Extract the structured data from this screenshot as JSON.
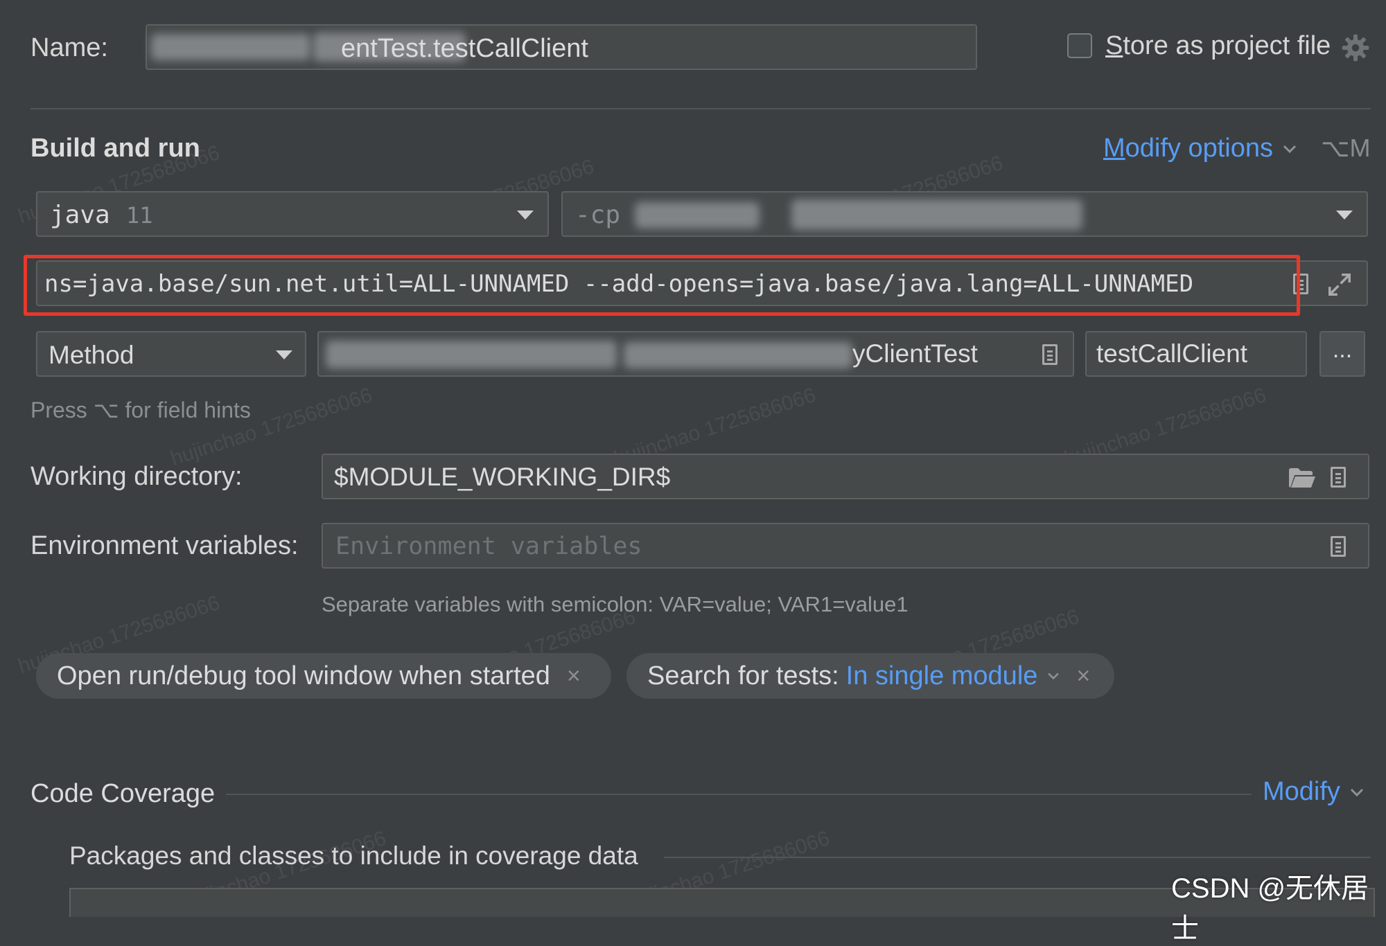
{
  "name_row": {
    "label": "Name:",
    "value_suffix": "entTest.testCallClient",
    "store_label_first": "S",
    "store_label_rest": "tore as project file"
  },
  "build_run": {
    "title": "Build and run",
    "modify_first": "M",
    "modify_rest": "odify options",
    "modify_shortcut": "⌥M",
    "jdk_name": "java",
    "jdk_version": "11",
    "cp_prefix": "-cp",
    "vm_options": "ns=java.base/sun.net.util=ALL-UNNAMED --add-opens=java.base/java.lang=ALL-UNNAMED",
    "test_kind": "Method",
    "class_suffix": "yClientTest",
    "method_name": "testCallClient",
    "more_button": "...",
    "hint": "Press ⌥ for field hints"
  },
  "working_dir": {
    "label": "Working directory:",
    "value": "$MODULE_WORKING_DIR$"
  },
  "env_vars": {
    "label": "Environment variables:",
    "placeholder": "Environment variables",
    "help": "Separate variables with semicolon: VAR=value; VAR1=value1"
  },
  "chips": {
    "open_tool_window": "Open run/debug tool window when started",
    "search_label": "Search for tests: ",
    "search_value": "In single module",
    "close_glyph": "×"
  },
  "coverage": {
    "title": "Code Coverage",
    "modify": "Modify",
    "packages_label": "Packages and classes to include in coverage data"
  },
  "watermark": {
    "footer": "CSDN @无休居士",
    "tiles": [
      "hujinchao 1725686066"
    ]
  },
  "colors": {
    "background": "#3c3f41",
    "field": "#45494a",
    "link": "#589df6",
    "highlight_box": "#e8382a"
  },
  "icons": {
    "gear": "gear-icon",
    "dropdown": "triangle-down-icon",
    "chevron": "chevron-down-icon",
    "document": "document-icon",
    "expand": "expand-icon",
    "folder": "folder-icon",
    "close": "close-icon"
  }
}
